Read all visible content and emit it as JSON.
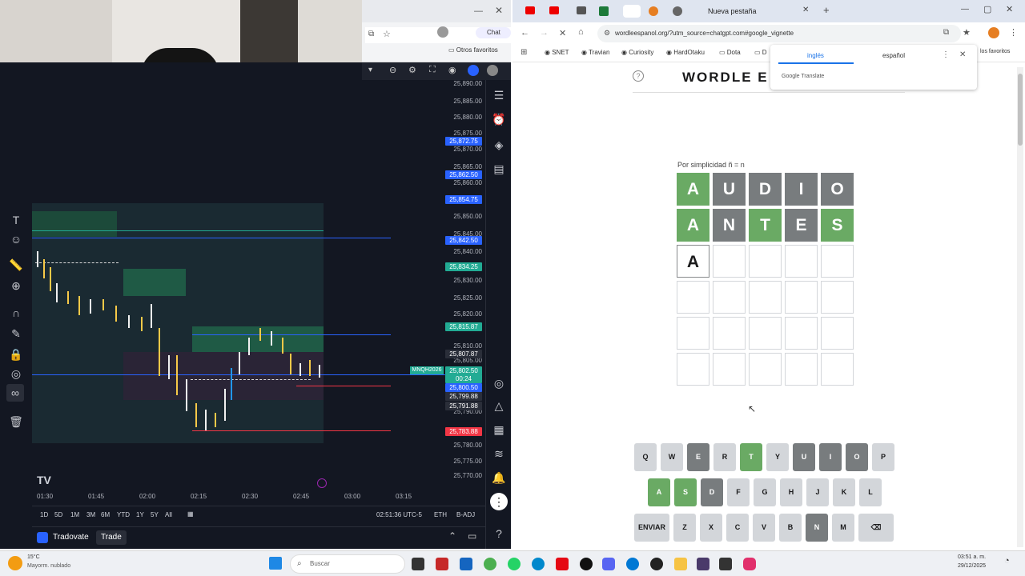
{
  "webcam": {
    "label": "webcam-feed"
  },
  "left_browser": {
    "chat_label": "Chat",
    "favorites_label": "Otros favoritos"
  },
  "trading": {
    "prices": [
      "25,890.00",
      "25,885.00",
      "25,880.00",
      "25,875.00",
      "25,870.00",
      "25,865.00",
      "25,860.00",
      "25,850.00",
      "25,845.00",
      "25,840.00",
      "25,830.00",
      "25,825.00",
      "25,820.00",
      "25,810.00",
      "25,805.00",
      "25,790.00",
      "25,780.00",
      "25,775.00",
      "25,770.00"
    ],
    "badges": [
      {
        "text": "25,872.75",
        "color": "#2962ff"
      },
      {
        "text": "25,862.50",
        "color": "#2962ff"
      },
      {
        "text": "25,854.75",
        "color": "#2962ff"
      },
      {
        "text": "25,842.50",
        "color": "#2962ff"
      },
      {
        "text": "25,834.25",
        "color": "#22ab94"
      },
      {
        "text": "25,815.87",
        "color": "#22ab94"
      },
      {
        "text": "25,807.87",
        "color": "#2a2e39"
      },
      {
        "text": "25,802.50",
        "color": "#22ab94"
      },
      {
        "text": "00:24",
        "color": "#22ab94"
      },
      {
        "text": "25,800.50",
        "color": "#2962ff"
      },
      {
        "text": "25,799.88",
        "color": "#2a2e39"
      },
      {
        "text": "25,791.88",
        "color": "#2a2e39"
      },
      {
        "text": "25,783.88",
        "color": "#f23645"
      }
    ],
    "symbol_tag": "MNQH2026",
    "time_labels": [
      "01:30",
      "01:45",
      "02:00",
      "02:15",
      "02:30",
      "02:45",
      "03:00",
      "03:15"
    ],
    "timeframes": [
      "1D",
      "5D",
      "1M",
      "3M",
      "6M",
      "YTD",
      "1Y",
      "5Y",
      "All"
    ],
    "clock": "02:51:36 UTC-5",
    "session": "ETH",
    "adj": "B-ADJ",
    "broker": "Tradovate",
    "trade_label": "Trade"
  },
  "browser": {
    "tab_title": "Nueva pestaña",
    "url": "wordleespanol.org/?utm_source=chatgpt.com#google_vignette",
    "bookmarks": [
      "SNET",
      "Travian",
      "Curiosity",
      "HardOtaku",
      "Dota",
      "D"
    ],
    "translate": {
      "lang1": "inglés",
      "lang2": "español",
      "brand": "Google Translate",
      "right_bm": "los favoritos"
    }
  },
  "wordle": {
    "title": "WORDLE E",
    "note": "Por simplicidad ñ = n",
    "rows": [
      [
        {
          "l": "A",
          "s": "green"
        },
        {
          "l": "U",
          "s": "gray"
        },
        {
          "l": "D",
          "s": "gray"
        },
        {
          "l": "I",
          "s": "gray"
        },
        {
          "l": "O",
          "s": "gray"
        }
      ],
      [
        {
          "l": "A",
          "s": "green"
        },
        {
          "l": "N",
          "s": "gray"
        },
        {
          "l": "T",
          "s": "green"
        },
        {
          "l": "E",
          "s": "gray"
        },
        {
          "l": "S",
          "s": "green"
        }
      ],
      [
        {
          "l": "A",
          "s": "typed"
        },
        {
          "l": "",
          "s": "empty"
        },
        {
          "l": "",
          "s": "empty"
        },
        {
          "l": "",
          "s": "empty"
        },
        {
          "l": "",
          "s": "empty"
        }
      ],
      [
        {
          "l": "",
          "s": "empty"
        },
        {
          "l": "",
          "s": "empty"
        },
        {
          "l": "",
          "s": "empty"
        },
        {
          "l": "",
          "s": "empty"
        },
        {
          "l": "",
          "s": "empty"
        }
      ],
      [
        {
          "l": "",
          "s": "empty"
        },
        {
          "l": "",
          "s": "empty"
        },
        {
          "l": "",
          "s": "empty"
        },
        {
          "l": "",
          "s": "empty"
        },
        {
          "l": "",
          "s": "empty"
        }
      ],
      [
        {
          "l": "",
          "s": "empty"
        },
        {
          "l": "",
          "s": "empty"
        },
        {
          "l": "",
          "s": "empty"
        },
        {
          "l": "",
          "s": "empty"
        },
        {
          "l": "",
          "s": "empty"
        }
      ]
    ],
    "keyboard": [
      [
        {
          "k": "Q",
          "s": ""
        },
        {
          "k": "W",
          "s": ""
        },
        {
          "k": "E",
          "s": "dark"
        },
        {
          "k": "R",
          "s": ""
        },
        {
          "k": "T",
          "s": "green"
        },
        {
          "k": "Y",
          "s": ""
        },
        {
          "k": "U",
          "s": "dark"
        },
        {
          "k": "I",
          "s": "dark"
        },
        {
          "k": "O",
          "s": "dark"
        },
        {
          "k": "P",
          "s": ""
        }
      ],
      [
        {
          "k": "A",
          "s": "green"
        },
        {
          "k": "S",
          "s": "green"
        },
        {
          "k": "D",
          "s": "dark"
        },
        {
          "k": "F",
          "s": ""
        },
        {
          "k": "G",
          "s": ""
        },
        {
          "k": "H",
          "s": ""
        },
        {
          "k": "J",
          "s": ""
        },
        {
          "k": "K",
          "s": ""
        },
        {
          "k": "L",
          "s": ""
        }
      ],
      [
        {
          "k": "ENVIAR",
          "s": ""
        },
        {
          "k": "Z",
          "s": ""
        },
        {
          "k": "X",
          "s": ""
        },
        {
          "k": "C",
          "s": ""
        },
        {
          "k": "V",
          "s": ""
        },
        {
          "k": "B",
          "s": ""
        },
        {
          "k": "N",
          "s": "dark"
        },
        {
          "k": "M",
          "s": ""
        },
        {
          "k": "⌫",
          "s": ""
        }
      ]
    ]
  },
  "taskbar": {
    "weather_temp": "15°C",
    "weather_desc": "Mayorm. nublado",
    "search_placeholder": "Buscar",
    "time": "03:51 a. m.",
    "date": "29/12/2025"
  }
}
